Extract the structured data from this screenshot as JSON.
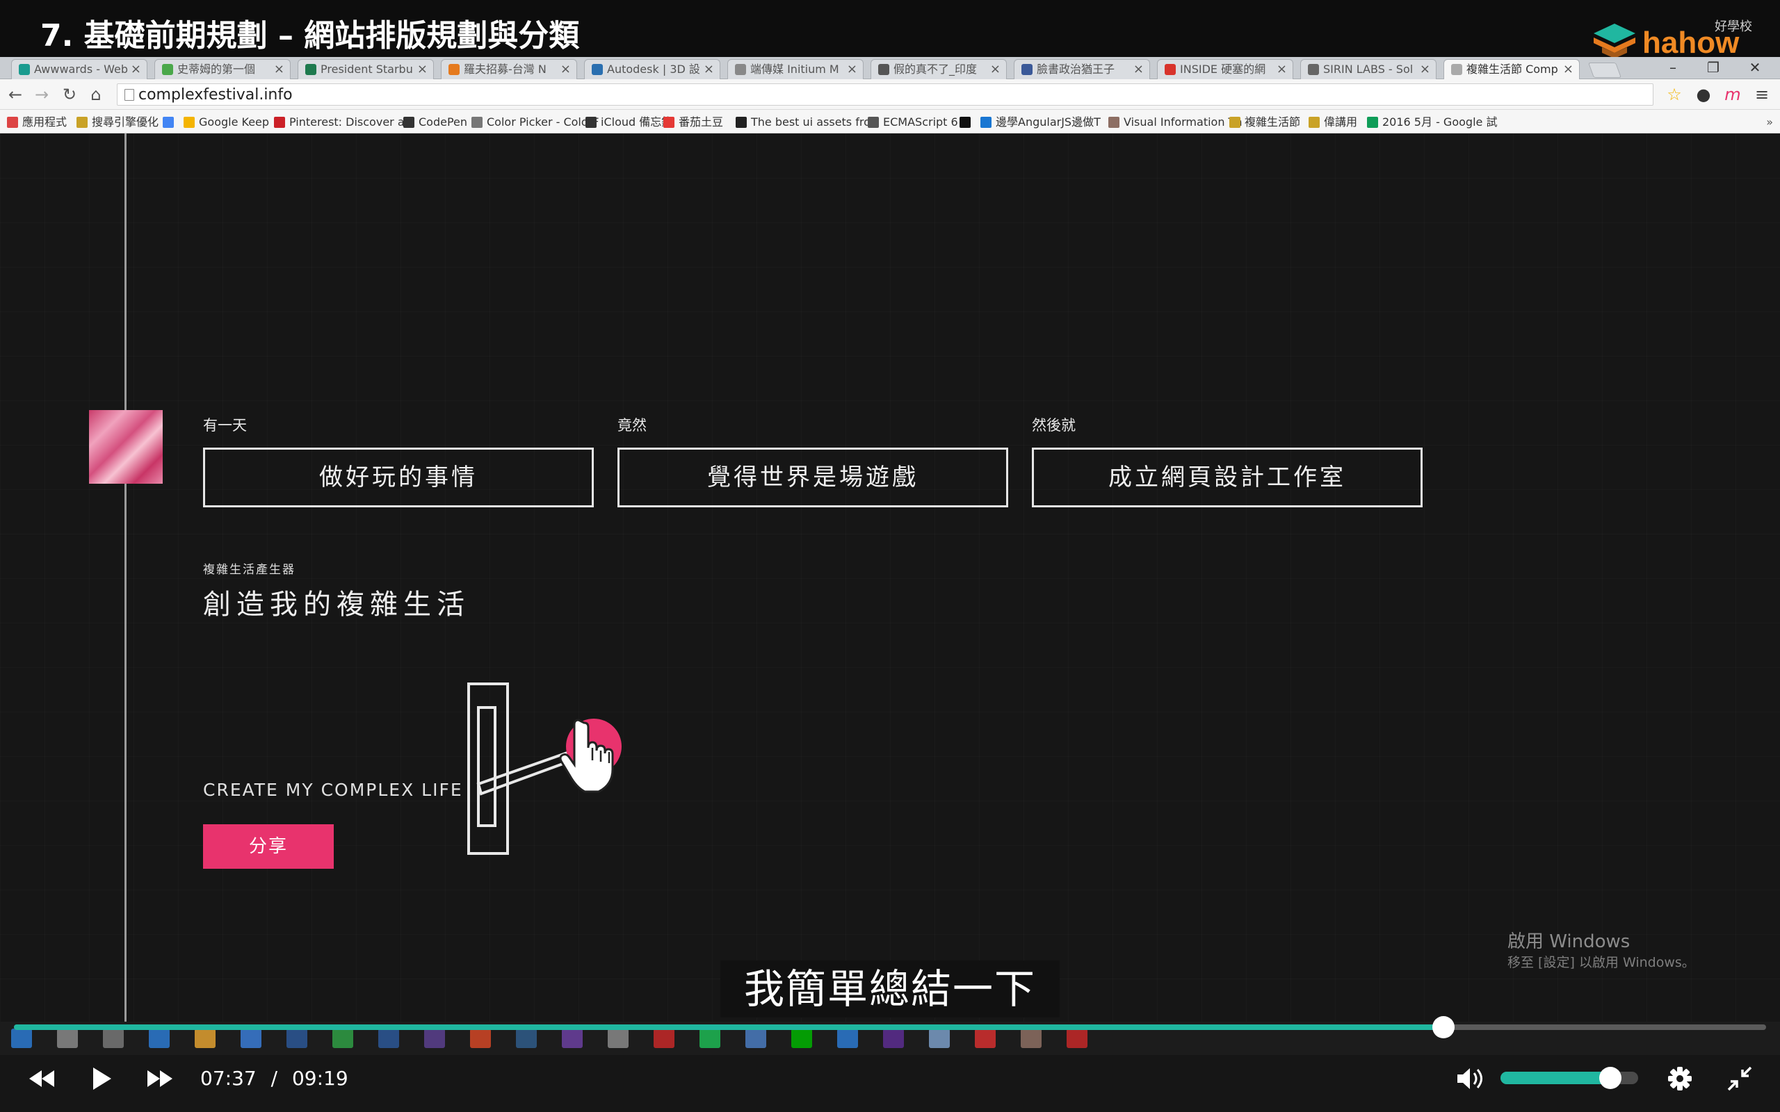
{
  "video": {
    "title": "7. 基礎前期規劃 – 網站排版規劃與分類",
    "subtitle": "我簡單總結一下",
    "brand": {
      "name": "hahow",
      "sub": "好學校"
    }
  },
  "browser": {
    "tabs": [
      {
        "label": "Awwwards - Web",
        "color": "#1a9b8f",
        "active": false
      },
      {
        "label": "史蒂姆的第一個",
        "color": "#4aa84a",
        "active": false
      },
      {
        "label": "President Starbu",
        "color": "#1e7a4e",
        "active": false
      },
      {
        "label": "羅夫招募-台灣 N",
        "color": "#e57a1e",
        "active": false
      },
      {
        "label": "Autodesk | 3D 設",
        "color": "#2a6fb0",
        "active": false
      },
      {
        "label": "端傳媒 Initium M",
        "color": "#888888",
        "active": false
      },
      {
        "label": "假的真不了_印度",
        "color": "#555555",
        "active": false
      },
      {
        "label": "臉書政治猶王子",
        "color": "#3b5998",
        "active": false
      },
      {
        "label": "INSIDE 硬塞的網",
        "color": "#d8332b",
        "active": false
      },
      {
        "label": "SIRIN LABS - Sol",
        "color": "#666666",
        "active": false
      },
      {
        "label": "複雜生活節 Comp",
        "color": "#aaaaaa",
        "active": true
      }
    ],
    "url": "complexfestival.info",
    "bookmarks": [
      {
        "label": "應用程式",
        "color": "#d44"
      },
      {
        "label": "搜尋引擎優化",
        "color": "#c9a227"
      },
      {
        "label": "",
        "color": "#4285f4"
      },
      {
        "label": "Google Keep",
        "color": "#f4b400"
      },
      {
        "label": "Pinterest: Discover a",
        "color": "#cb2027"
      },
      {
        "label": "CodePen",
        "color": "#333333"
      },
      {
        "label": "Color Picker - ColorF",
        "color": "#777777"
      },
      {
        "label": "iCloud 備忘錄",
        "color": "#333333"
      },
      {
        "label": "番茄土豆",
        "color": "#e53935"
      },
      {
        "label": "The best ui assets fro",
        "color": "#222222"
      },
      {
        "label": "ECMAScript 6",
        "color": "#555555"
      },
      {
        "label": "",
        "color": "#111111"
      },
      {
        "label": "邊學AngularJS邊做T",
        "color": "#1976d2"
      },
      {
        "label": "Visual Information Th",
        "color": "#8d6e63"
      },
      {
        "label": "複雜生活節",
        "color": "#c9a227"
      },
      {
        "label": "偉講用",
        "color": "#c9a227"
      },
      {
        "label": "2016 5月 - Google 試",
        "color": "#0f9d58"
      }
    ]
  },
  "page": {
    "columns": [
      {
        "label": "有一天",
        "box": "做好玩的事情"
      },
      {
        "label": "竟然",
        "box": "覺得世界是場遊戲"
      },
      {
        "label": "然後就",
        "box": "成立網頁設計工作室"
      }
    ],
    "tag": "複雜生活產生器",
    "headline": "創造我的複雜生活",
    "headline_en": "CREATE MY COMPLEX LIFE",
    "share_label": "分享",
    "accent": "#e8336d"
  },
  "windows_watermark": {
    "title": "啟用 Windows",
    "sub": "移至 [設定] 以啟用 Windows。"
  },
  "player": {
    "current_time": "07:37",
    "separator": "/",
    "total_time": "09:19",
    "progress": 0.8157,
    "volume": 0.8,
    "accent": "#20b7a0"
  }
}
